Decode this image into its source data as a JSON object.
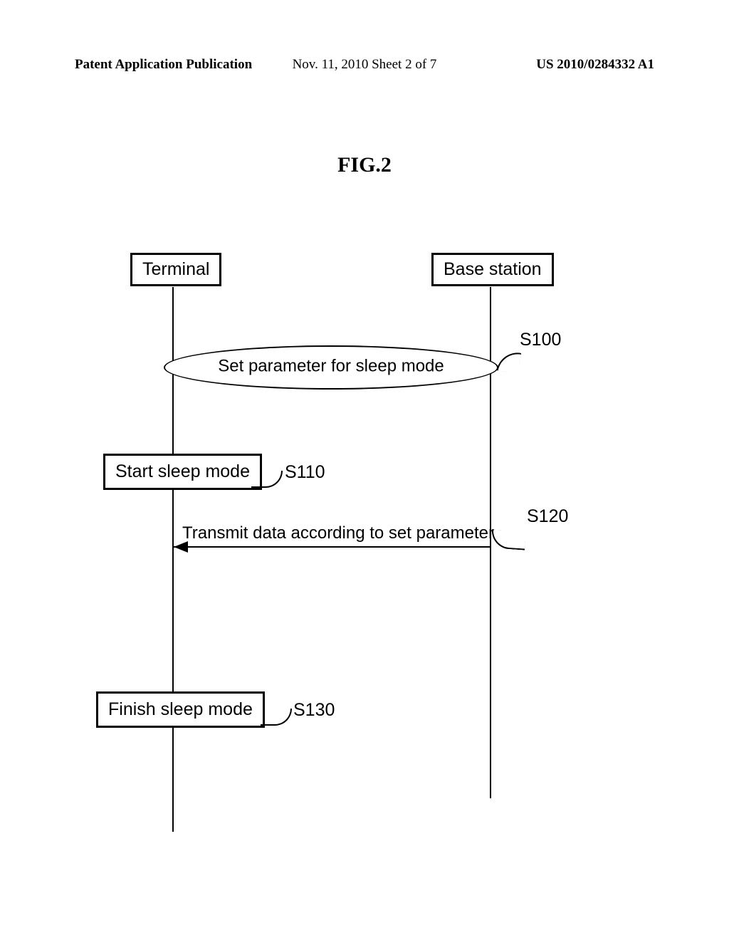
{
  "header": {
    "left": "Patent Application Publication",
    "center": "Nov. 11, 2010  Sheet 2 of 7",
    "right": "US 2010/0284332 A1"
  },
  "figure": {
    "title": "FIG.2"
  },
  "diagram": {
    "participants": {
      "terminal": "Terminal",
      "base_station": "Base station"
    },
    "steps": {
      "s100": {
        "text": "Set parameter for sleep mode",
        "label": "S100"
      },
      "s110": {
        "text": "Start sleep mode",
        "label": "S110"
      },
      "s120": {
        "text": "Transmit data according to set parameter",
        "label": "S120"
      },
      "s130": {
        "text": "Finish sleep mode",
        "label": "S130"
      }
    }
  }
}
